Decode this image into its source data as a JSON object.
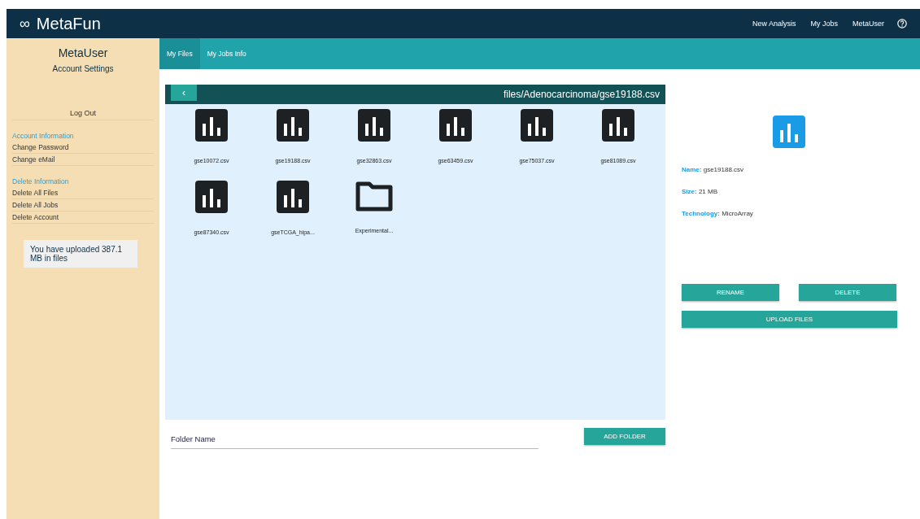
{
  "header": {
    "logo_mark": "∞",
    "title": "MetaFun",
    "nav": [
      "New Analysis",
      "My Jobs",
      "MetaUser"
    ]
  },
  "sidebar": {
    "user": "MetaUser",
    "subtitle": "Account Settings",
    "logout": "Log Out",
    "sections": [
      {
        "heading": "Account Information",
        "items": [
          "Change Password",
          "Change eMail"
        ]
      },
      {
        "heading": "Delete Information",
        "items": [
          "Delete All Files",
          "Delete All Jobs",
          "Delete Account"
        ]
      }
    ],
    "usage": "You have uploaded 387.1 MB in files"
  },
  "tabs": [
    {
      "label": "My Files",
      "selected": true
    },
    {
      "label": "My Jobs Info",
      "selected": false
    }
  ],
  "browser": {
    "back": "‹",
    "path": "files/Adenocarcinoma/gse19188.csv",
    "items": [
      {
        "kind": "file",
        "name": "gse10072.csv"
      },
      {
        "kind": "file",
        "name": "gse19188.csv"
      },
      {
        "kind": "file",
        "name": "gse32863.csv"
      },
      {
        "kind": "file",
        "name": "gse63459.csv"
      },
      {
        "kind": "file",
        "name": "gse75037.csv"
      },
      {
        "kind": "file",
        "name": "gse81089.csv"
      },
      {
        "kind": "file",
        "name": "gse87340.csv"
      },
      {
        "kind": "file",
        "name": "gseTCGA_hipa..."
      },
      {
        "kind": "folder",
        "name": "Experimental..."
      }
    ],
    "folder_field": {
      "placeholder": "Folder Name"
    },
    "add_folder": "ADD FOLDER"
  },
  "details": {
    "fields": [
      {
        "label": "Name:",
        "value": "gse19188.csv"
      },
      {
        "label": "Size:",
        "value": "21 MB"
      },
      {
        "label": "Technology:",
        "value": "MicroArray"
      }
    ],
    "buttons": [
      "RENAME",
      "DELETE"
    ],
    "upload": "UPLOAD FILES"
  }
}
